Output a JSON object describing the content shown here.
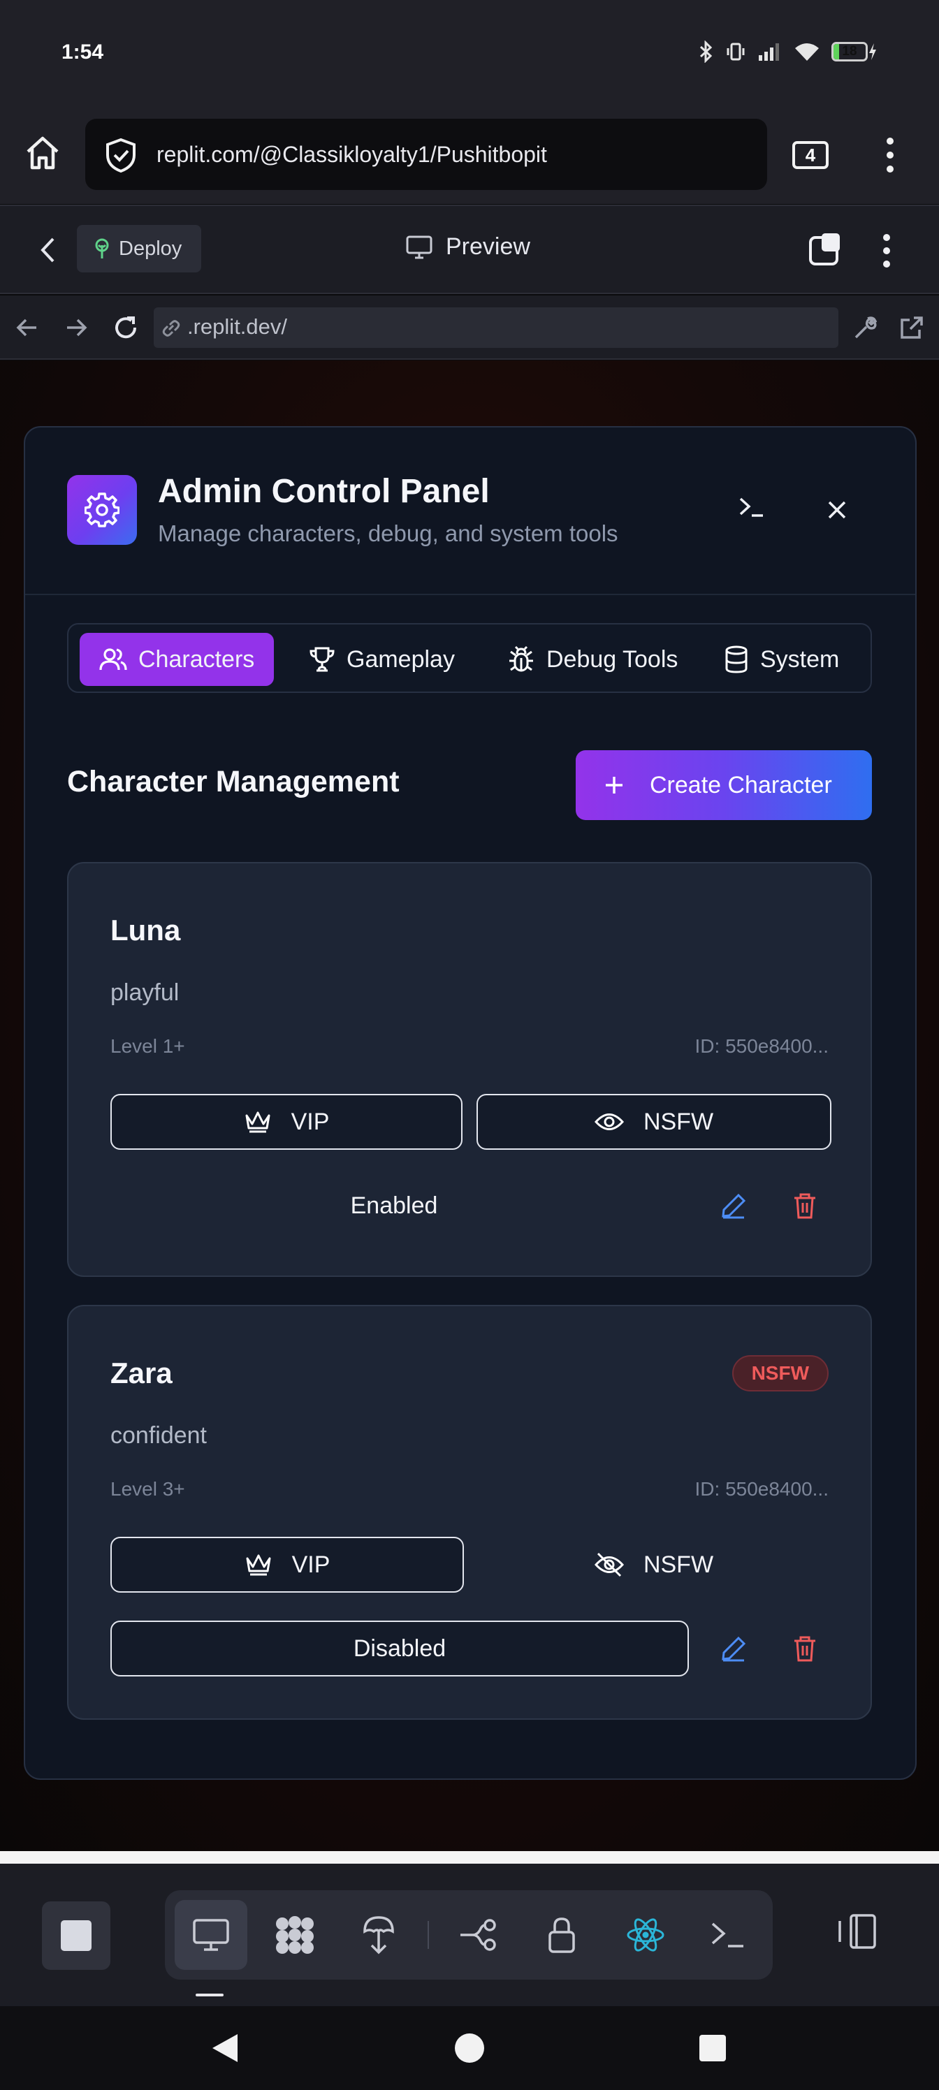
{
  "status_bar": {
    "time": "1:54",
    "battery_level": "18",
    "battery_fraction": 0.18
  },
  "browser": {
    "url": "replit.com/@Classikloyalty1/Pushitbopit",
    "tab_count": "4"
  },
  "replit_header": {
    "deploy_label": "Deploy",
    "preview_label": "Preview"
  },
  "preview_address": {
    "url": ".replit.dev/"
  },
  "modal": {
    "title": "Admin Control Panel",
    "subtitle": "Manage characters, debug, and system tools",
    "tabs": [
      {
        "label": "Characters",
        "icon": "users-icon",
        "active": true
      },
      {
        "label": "Gameplay",
        "icon": "trophy-icon",
        "active": false
      },
      {
        "label": "Debug Tools",
        "icon": "bug-icon",
        "active": false
      },
      {
        "label": "System",
        "icon": "database-icon",
        "active": false
      }
    ],
    "section_title": "Character Management",
    "create_button": "Create Character",
    "characters": [
      {
        "name": "Luna",
        "personality": "playful",
        "level": "Level 1+",
        "id": "ID: 550e8400...",
        "vip_label": "VIP",
        "nsfw_label": "NSFW",
        "status": "Enabled",
        "badge": ""
      },
      {
        "name": "Zara",
        "personality": "confident",
        "level": "Level 3+",
        "id": "ID: 550e8400...",
        "vip_label": "VIP",
        "nsfw_label": "NSFW",
        "status": "Disabled",
        "badge": "NSFW"
      }
    ]
  },
  "colors": {
    "accent_purple": "#9333ea",
    "accent_blue": "#2f6ef0",
    "danger_red": "#ef5b5b",
    "edit_blue": "#4d8df5",
    "react_cyan": "#2bb6d8"
  }
}
